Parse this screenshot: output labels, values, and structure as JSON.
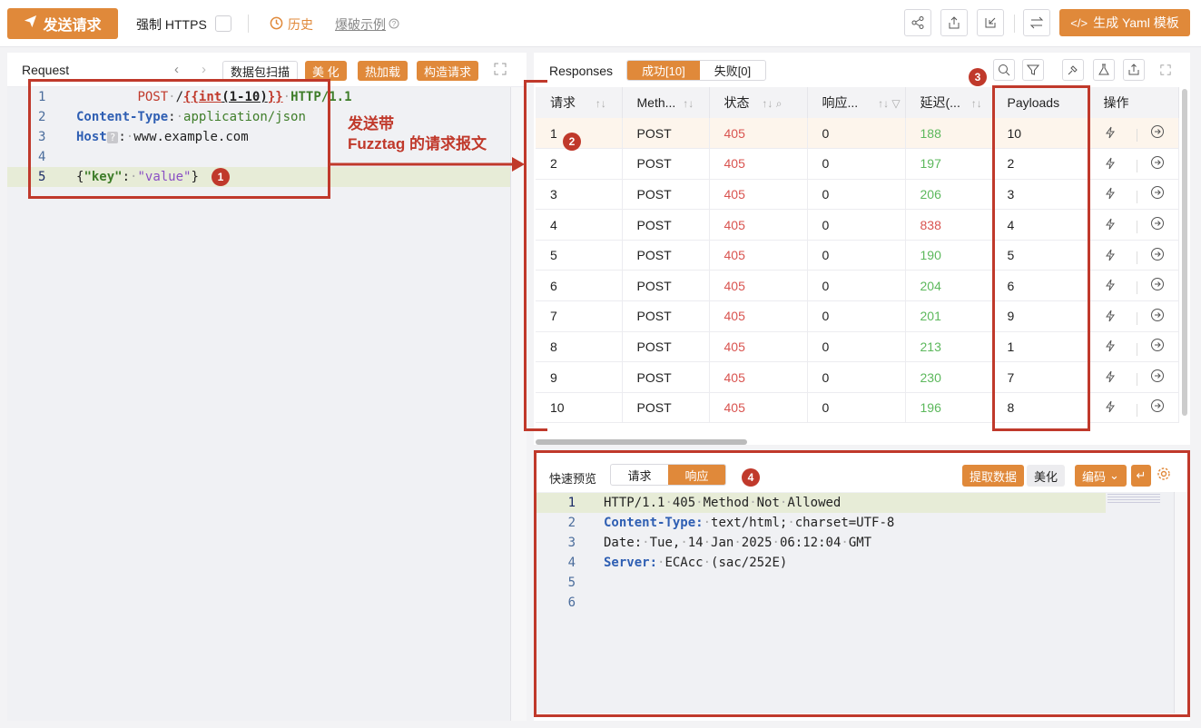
{
  "toolbar": {
    "send_label": "发送请求",
    "https_label": "强制 HTTPS",
    "history_label": "历史",
    "example_label": "爆破示例",
    "yaml_label": "生成 Yaml 模板"
  },
  "request": {
    "title": "Request",
    "buttons": [
      "数据包扫描",
      "美 化",
      "热加载",
      "构造请求"
    ],
    "lines": [
      {
        "no": "1",
        "method": "POST",
        "path_pre": "/",
        "fuzz_open": "{{",
        "fuzz_fn": "int",
        "fuzz_arg": "(1-10)",
        "fuzz_close": "}}",
        "proto": "HTTP/1.1"
      },
      {
        "no": "2",
        "key": "Content-Type",
        "value": "application/json"
      },
      {
        "no": "3",
        "key": "Host",
        "value": "www.example.com"
      },
      {
        "no": "4"
      },
      {
        "no": "5",
        "json_key": "\"key\"",
        "json_val": "\"value\""
      }
    ]
  },
  "annotation": {
    "text_line1": "发送带",
    "text_line2": "Fuzztag 的请求报文",
    "badges": [
      "1",
      "2",
      "3",
      "4"
    ]
  },
  "responses": {
    "title": "Responses",
    "tab_success": "成功[10]",
    "tab_fail": "失败[0]",
    "columns": [
      "请求",
      "Meth...",
      "状态",
      "响应...",
      "延迟(...",
      "Payloads",
      "操作"
    ],
    "rows": [
      {
        "id": "1",
        "method": "POST",
        "status": "405",
        "resp": "0",
        "latency": "188",
        "payload": "10"
      },
      {
        "id": "2",
        "method": "POST",
        "status": "405",
        "resp": "0",
        "latency": "197",
        "payload": "2"
      },
      {
        "id": "3",
        "method": "POST",
        "status": "405",
        "resp": "0",
        "latency": "206",
        "payload": "3"
      },
      {
        "id": "4",
        "method": "POST",
        "status": "405",
        "resp": "0",
        "latency": "838",
        "payload": "4"
      },
      {
        "id": "5",
        "method": "POST",
        "status": "405",
        "resp": "0",
        "latency": "190",
        "payload": "5"
      },
      {
        "id": "6",
        "method": "POST",
        "status": "405",
        "resp": "0",
        "latency": "204",
        "payload": "6"
      },
      {
        "id": "7",
        "method": "POST",
        "status": "405",
        "resp": "0",
        "latency": "201",
        "payload": "9"
      },
      {
        "id": "8",
        "method": "POST",
        "status": "405",
        "resp": "0",
        "latency": "213",
        "payload": "1"
      },
      {
        "id": "9",
        "method": "POST",
        "status": "405",
        "resp": "0",
        "latency": "230",
        "payload": "7"
      },
      {
        "id": "10",
        "method": "POST",
        "status": "405",
        "resp": "0",
        "latency": "196",
        "payload": "8"
      }
    ]
  },
  "preview": {
    "title": "快速预览",
    "tab_request": "请求",
    "tab_response": "响应",
    "btn_extract": "提取数据",
    "btn_beautify": "美化",
    "btn_encode": "编码",
    "lines": [
      {
        "no": "1",
        "text": "HTTP/1.1 405 Method Not Allowed"
      },
      {
        "no": "2",
        "key": "Content-Type:",
        "value": " text/html; charset=UTF-8"
      },
      {
        "no": "3",
        "text": "Date: Tue, 14 Jan 2025 06:12:04 GMT"
      },
      {
        "no": "4",
        "key": "Server:",
        "value": " ECAcc (sac/252E)"
      },
      {
        "no": "5"
      },
      {
        "no": "6"
      }
    ]
  },
  "colors": {
    "accent": "#e0893a",
    "annotation": "#c0392b"
  }
}
